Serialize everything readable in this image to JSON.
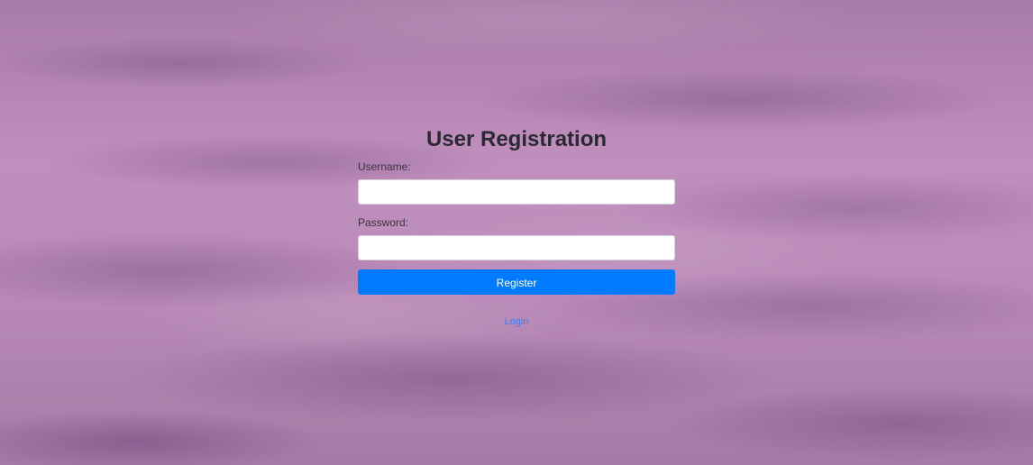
{
  "page": {
    "title": "User Registration",
    "background_color": "#b583b3"
  },
  "form": {
    "username_label": "Username:",
    "username_value": "",
    "password_label": "Password:",
    "password_value": "",
    "submit_label": "Register",
    "submit_color": "#007bff"
  },
  "footer": {
    "login_link": "Login",
    "link_color": "#3b7ff0"
  }
}
